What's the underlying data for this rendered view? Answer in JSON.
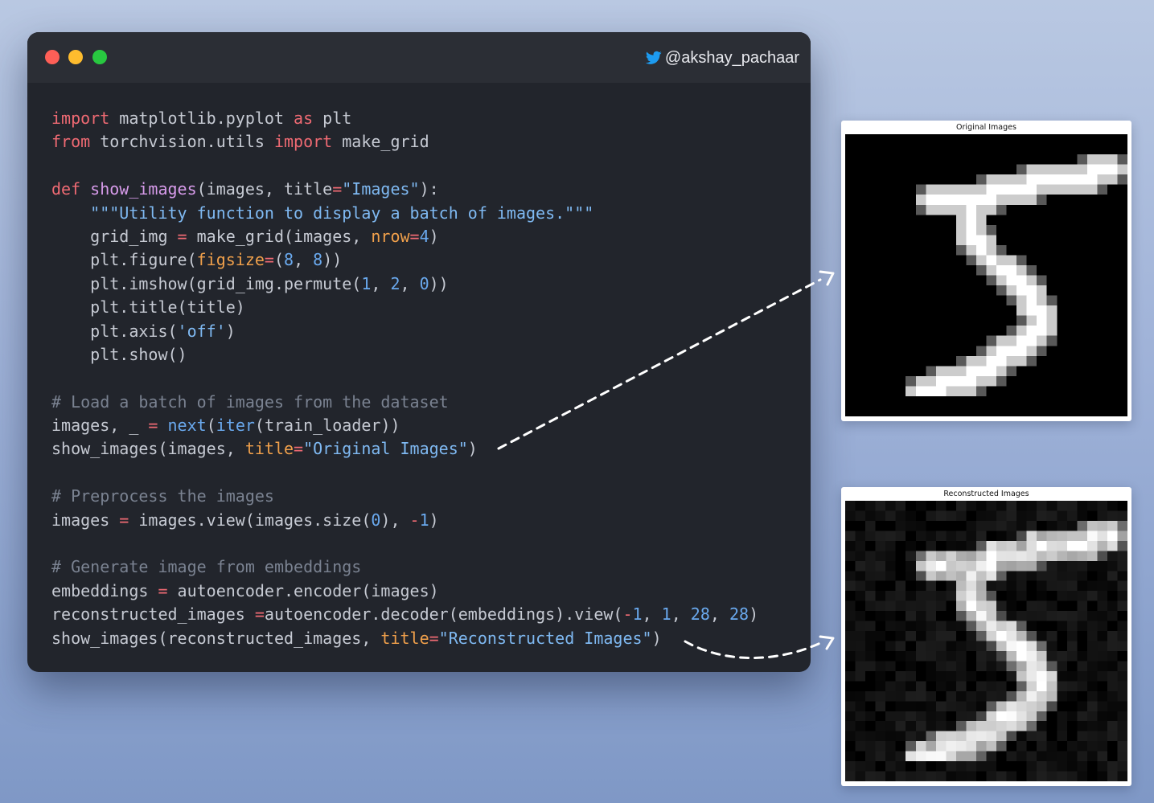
{
  "window": {
    "handle": "@akshay_pachaar",
    "icons": [
      "close-dot",
      "minimize-dot",
      "zoom-dot",
      "twitter-bird-icon"
    ]
  },
  "code": {
    "lines": [
      [
        [
          "kw",
          "import"
        ],
        [
          "t",
          " matplotlib.pyplot "
        ],
        [
          "kw",
          "as"
        ],
        [
          "t",
          " plt"
        ]
      ],
      [
        [
          "kw",
          "from"
        ],
        [
          "t",
          " torchvision.utils "
        ],
        [
          "kw",
          "import"
        ],
        [
          "t",
          " make_grid"
        ]
      ],
      [],
      [
        [
          "kw",
          "def"
        ],
        [
          "t",
          " "
        ],
        [
          "fn",
          "show_images"
        ],
        [
          "t",
          "(images, title"
        ],
        [
          "op",
          "="
        ],
        [
          "str",
          "\"Images\""
        ],
        [
          "t",
          "):"
        ]
      ],
      [
        [
          "t",
          "    "
        ],
        [
          "str",
          "\"\"\"Utility function to display a batch of images.\"\"\""
        ]
      ],
      [
        [
          "t",
          "    grid_img "
        ],
        [
          "op",
          "="
        ],
        [
          "t",
          " make_grid(images, "
        ],
        [
          "prm",
          "nrow"
        ],
        [
          "op",
          "="
        ],
        [
          "num",
          "4"
        ],
        [
          "t",
          ")"
        ]
      ],
      [
        [
          "t",
          "    plt.figure("
        ],
        [
          "prm",
          "figsize"
        ],
        [
          "op",
          "="
        ],
        [
          "t",
          "("
        ],
        [
          "num",
          "8"
        ],
        [
          "t",
          ", "
        ],
        [
          "num",
          "8"
        ],
        [
          "t",
          "))"
        ]
      ],
      [
        [
          "t",
          "    plt.imshow(grid_img.permute("
        ],
        [
          "num",
          "1"
        ],
        [
          "t",
          ", "
        ],
        [
          "num",
          "2"
        ],
        [
          "t",
          ", "
        ],
        [
          "num",
          "0"
        ],
        [
          "t",
          "))"
        ]
      ],
      [
        [
          "t",
          "    plt.title(title)"
        ]
      ],
      [
        [
          "t",
          "    plt.axis("
        ],
        [
          "str",
          "'off'"
        ],
        [
          "t",
          ")"
        ]
      ],
      [
        [
          "t",
          "    plt.show()"
        ]
      ],
      [],
      [
        [
          "cm",
          "# Load a batch of images from the dataset"
        ]
      ],
      [
        [
          "t",
          "images, _ "
        ],
        [
          "op",
          "="
        ],
        [
          "t",
          " "
        ],
        [
          "bi",
          "next"
        ],
        [
          "t",
          "("
        ],
        [
          "bi",
          "iter"
        ],
        [
          "t",
          "(train_loader))"
        ]
      ],
      [
        [
          "t",
          "show_images(images, "
        ],
        [
          "prm",
          "title"
        ],
        [
          "op",
          "="
        ],
        [
          "str",
          "\"Original Images\""
        ],
        [
          "t",
          ")"
        ]
      ],
      [],
      [
        [
          "cm",
          "# Preprocess the images"
        ]
      ],
      [
        [
          "t",
          "images "
        ],
        [
          "op",
          "="
        ],
        [
          "t",
          " images.view(images.size("
        ],
        [
          "num",
          "0"
        ],
        [
          "t",
          "), "
        ],
        [
          "op",
          "-"
        ],
        [
          "num",
          "1"
        ],
        [
          "t",
          ")"
        ]
      ],
      [],
      [
        [
          "cm",
          "# Generate image from embeddings"
        ]
      ],
      [
        [
          "t",
          "embeddings "
        ],
        [
          "op",
          "="
        ],
        [
          "t",
          " autoencoder.encoder(images)"
        ]
      ],
      [
        [
          "t",
          "reconstructed_images "
        ],
        [
          "op",
          "="
        ],
        [
          "t",
          "autoencoder.decoder(embeddings).view("
        ],
        [
          "op",
          "-"
        ],
        [
          "num",
          "1"
        ],
        [
          "t",
          ", "
        ],
        [
          "num",
          "1"
        ],
        [
          "t",
          ", "
        ],
        [
          "num",
          "28"
        ],
        [
          "t",
          ", "
        ],
        [
          "num",
          "28"
        ],
        [
          "t",
          ")"
        ]
      ],
      [
        [
          "t",
          "show_images(reconstructed_images, "
        ],
        [
          "prm",
          "title"
        ],
        [
          "op",
          "="
        ],
        [
          "str",
          "\"Reconstructed Images\""
        ],
        [
          "t",
          ")"
        ]
      ]
    ]
  },
  "images": {
    "original_title": "Original Images",
    "reconstructed_title": "Reconstructed Images"
  },
  "colors": {
    "background": "#9fb2d8",
    "editor": "#22252c",
    "keyword": "#ef6a73",
    "string": "#7fb9f2",
    "param": "#f0a04b",
    "comment": "#7a8291"
  }
}
